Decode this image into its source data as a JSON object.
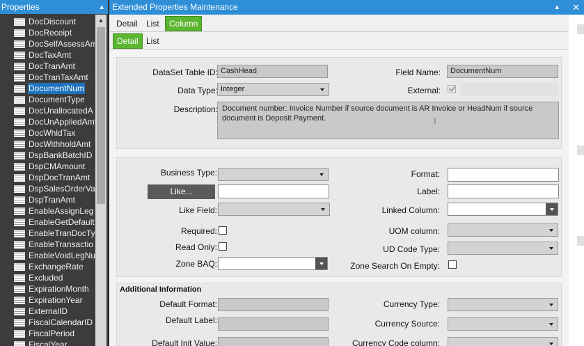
{
  "left_panel": {
    "title": "Properties",
    "pin_glyph": "▴",
    "scroll_up_glyph": "▲",
    "items": [
      {
        "label": "DocDiscount"
      },
      {
        "label": "DocReceipt"
      },
      {
        "label": "DocSelfAssessAm"
      },
      {
        "label": "DocTaxAmt"
      },
      {
        "label": "DocTranAmt"
      },
      {
        "label": "DocTranTaxAmt"
      },
      {
        "label": "DocumentNum",
        "selected": true
      },
      {
        "label": "DocumentType"
      },
      {
        "label": "DocUnallocatedA"
      },
      {
        "label": "DocUnAppliedAmt"
      },
      {
        "label": "DocWhldTax"
      },
      {
        "label": "DocWithholdAmt"
      },
      {
        "label": "DspBankBatchID"
      },
      {
        "label": "DspCMAmount"
      },
      {
        "label": "DspDocTranAmt"
      },
      {
        "label": "DspSalesOrderVal"
      },
      {
        "label": "DspTranAmt"
      },
      {
        "label": "EnableAssignLeg"
      },
      {
        "label": "EnableGetDefault"
      },
      {
        "label": "EnableTranDocTy"
      },
      {
        "label": "EnableTransactio"
      },
      {
        "label": "EnableVoidLegNu"
      },
      {
        "label": "ExchangeRate"
      },
      {
        "label": "Excluded"
      },
      {
        "label": "ExpirationMonth"
      },
      {
        "label": "ExpirationYear"
      },
      {
        "label": "ExternalID"
      },
      {
        "label": "FiscalCalendarID"
      },
      {
        "label": "FiscalPeriod"
      },
      {
        "label": "FiscalYear"
      }
    ]
  },
  "window": {
    "title": "Extended Properties Maintenance",
    "pin_glyph": "▴",
    "close_glyph": "✕"
  },
  "tabs_top": [
    {
      "label": "Detail"
    },
    {
      "label": "List"
    },
    {
      "label": "Column",
      "active": true
    }
  ],
  "tabs_sub": [
    {
      "label": "Detail",
      "active": true
    },
    {
      "label": "List"
    }
  ],
  "detail": {
    "dataset_label": "DataSet Table ID:",
    "dataset_value": "CashHead",
    "field_name_label": "Field Name:",
    "field_name_value": "DocumentNum",
    "data_type_label": "Data Type:",
    "data_type_value": "Integer",
    "external_label": "External:",
    "external_checked": true,
    "description_label": "Description:",
    "description_value": "Document number: Invoice Number if source document is AR Invoice or HeadNum if source document is Deposit Payment.",
    "cursor_glyph": "I"
  },
  "properties": {
    "business_type_label": "Business Type:",
    "business_type_value": "",
    "format_label": "Format:",
    "format_value": "",
    "like_button": "Like...",
    "like_value": "",
    "label_label": "Label:",
    "label_value": "",
    "like_field_label": "Like Field:",
    "like_field_value": "",
    "linked_column_label": "Linked Column:",
    "linked_column_value": "",
    "required_label": "Required:",
    "uom_column_label": "UOM column:",
    "uom_column_value": "",
    "read_only_label": "Read Only:",
    "ud_code_type_label": "UD Code Type:",
    "ud_code_type_value": "",
    "zone_baq_label": "Zone BAQ:",
    "zone_baq_value": "",
    "zone_search_label": "Zone Search On Empty:"
  },
  "additional": {
    "title": "Additional Information",
    "default_format_label": "Default Format:",
    "default_format_value": "",
    "currency_type_label": "Currency Type:",
    "currency_type_value": "",
    "default_label_label": "Default Label:",
    "default_label_value": "",
    "currency_source_label": "Currency Source:",
    "currency_source_value": "",
    "default_init_label": "Default Init Value:",
    "default_init_value": "",
    "currency_code_label": "Currency Code column:",
    "currency_code_value": ""
  },
  "colors": {
    "header_blue": "#2f8fd6",
    "tab_green": "#5cb531",
    "tree_bg": "#3c3c3c",
    "selected_blue": "#1e73be"
  }
}
